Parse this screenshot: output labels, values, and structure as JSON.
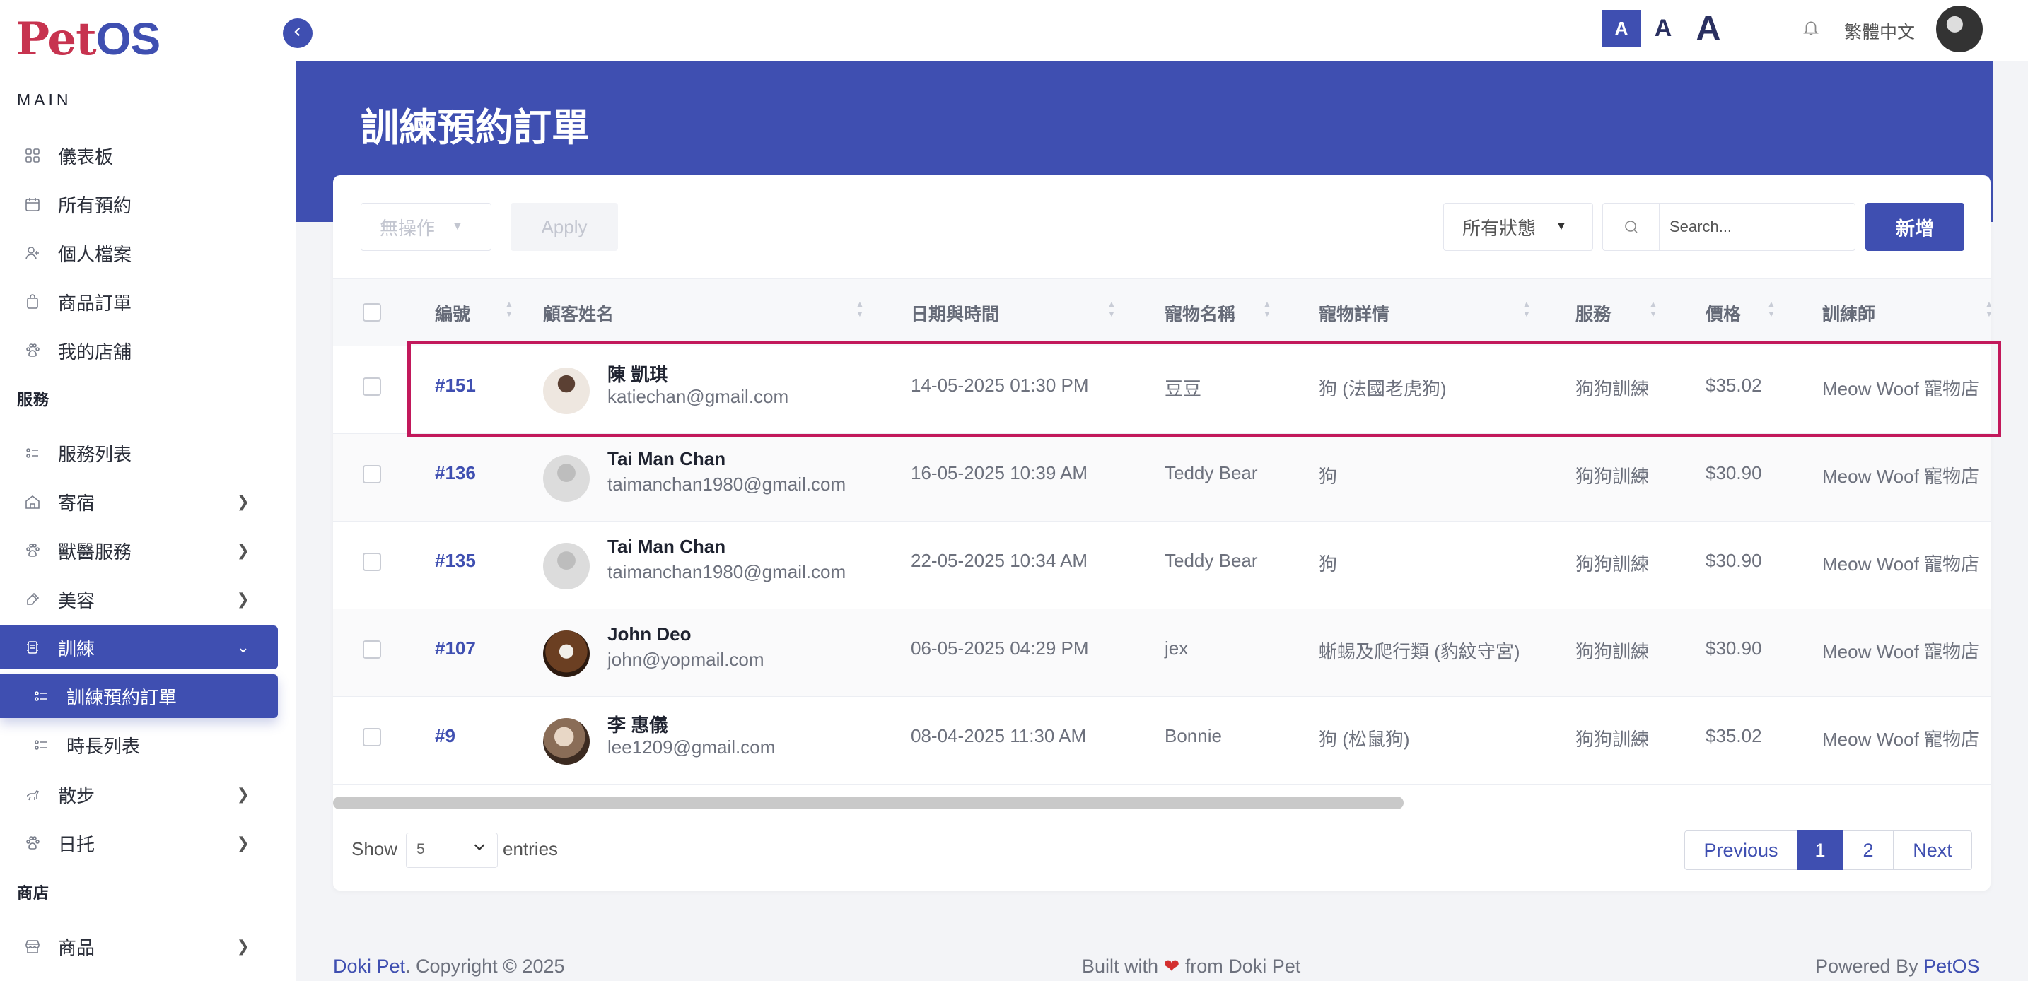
{
  "app": {
    "logo_pet": "Pet",
    "logo_os": "OS"
  },
  "sidebar": {
    "section_main": "MAIN",
    "section_services": "服務",
    "section_shop": "商店",
    "items": [
      {
        "label": "儀表板",
        "icon": "grid-icon"
      },
      {
        "label": "所有預約",
        "icon": "calendar-icon"
      },
      {
        "label": "個人檔案",
        "icon": "user-icon"
      },
      {
        "label": "商品訂單",
        "icon": "bag-icon"
      },
      {
        "label": "我的店舖",
        "icon": "paw-icon"
      },
      {
        "label": "服務列表",
        "icon": "list-icon"
      },
      {
        "label": "寄宿",
        "icon": "home-icon"
      },
      {
        "label": "獸醫服務",
        "icon": "vet-icon"
      },
      {
        "label": "美容",
        "icon": "brush-icon"
      },
      {
        "label": "訓練",
        "icon": "training-icon"
      },
      {
        "label": "訓練預約訂單",
        "icon": "list-icon"
      },
      {
        "label": "時長列表",
        "icon": "list-icon"
      },
      {
        "label": "散步",
        "icon": "walk-icon"
      },
      {
        "label": "日托",
        "icon": "paw-icon"
      },
      {
        "label": "商品",
        "icon": "store-icon"
      }
    ]
  },
  "topbar": {
    "font_small": "A",
    "font_medium": "A",
    "font_large": "A",
    "language": "繁體中文"
  },
  "page": {
    "title": "訓練預約訂單"
  },
  "toolbar": {
    "bulk_action": "無操作",
    "apply": "Apply",
    "status_filter": "所有狀態",
    "search_placeholder": "Search...",
    "add": "新增"
  },
  "table": {
    "headers": [
      "編號",
      "顧客姓名",
      "日期與時間",
      "寵物名稱",
      "寵物詳情",
      "服務",
      "價格",
      "訓練師"
    ],
    "rows": [
      {
        "id": "#151",
        "name": "陳 凱琪",
        "email": "katiechan@gmail.com",
        "datetime": "14-05-2025 01:30 PM",
        "pet": "豆豆",
        "details": "狗 (法國老虎狗)",
        "service": "狗狗訓練",
        "price": "$35.02",
        "trainer": "Meow Woof 寵物店"
      },
      {
        "id": "#136",
        "name": "Tai Man Chan",
        "email": "taimanchan1980@gmail.com",
        "datetime": "16-05-2025 10:39 AM",
        "pet": "Teddy Bear",
        "details": "狗",
        "service": "狗狗訓練",
        "price": "$30.90",
        "trainer": "Meow Woof 寵物店"
      },
      {
        "id": "#135",
        "name": "Tai Man Chan",
        "email": "taimanchan1980@gmail.com",
        "datetime": "22-05-2025 10:34 AM",
        "pet": "Teddy Bear",
        "details": "狗",
        "service": "狗狗訓練",
        "price": "$30.90",
        "trainer": "Meow Woof 寵物店"
      },
      {
        "id": "#107",
        "name": "John Deo",
        "email": "john@yopmail.com",
        "datetime": "06-05-2025 04:29 PM",
        "pet": "jex",
        "details": "蜥蜴及爬行類 (豹紋守宮)",
        "service": "狗狗訓練",
        "price": "$30.90",
        "trainer": "Meow Woof 寵物店"
      },
      {
        "id": "#9",
        "name": "李 惠儀",
        "email": "lee1209@gmail.com",
        "datetime": "08-04-2025 11:30 AM",
        "pet": "Bonnie",
        "details": "狗 (松鼠狗)",
        "service": "狗狗訓練",
        "price": "$35.02",
        "trainer": "Meow Woof 寵物店"
      }
    ]
  },
  "pagination": {
    "show": "Show",
    "page_size": "5",
    "entries": "entries",
    "previous": "Previous",
    "page1": "1",
    "page2": "2",
    "next": "Next"
  },
  "footer": {
    "brand": "Doki Pet",
    "copyright": ". Copyright © 2025",
    "built_prefix": "Built with",
    "built_suffix": "from Doki Pet",
    "powered_prefix": "Powered By",
    "powered_brand": "PetOS"
  },
  "colors": {
    "primary": "#3f4fb1",
    "highlight": "#c2185b",
    "logo_red": "#c7334f"
  }
}
